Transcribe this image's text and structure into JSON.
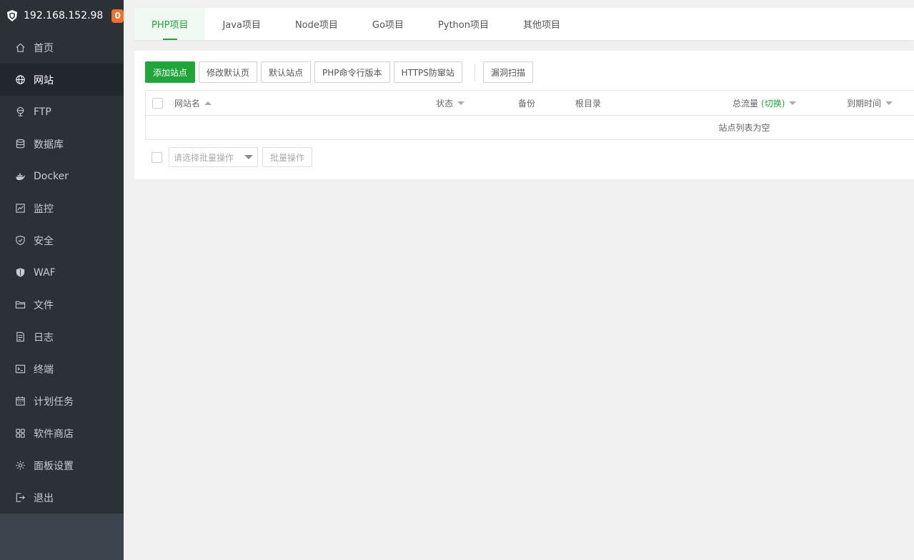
{
  "header": {
    "ip": "192.168.152.98",
    "badge": "0"
  },
  "nav": [
    {
      "label": "首页",
      "icon": "home-icon"
    },
    {
      "label": "网站",
      "icon": "globe-icon",
      "active": true
    },
    {
      "label": "FTP",
      "icon": "ftp-icon"
    },
    {
      "label": "数据库",
      "icon": "database-icon"
    },
    {
      "label": "Docker",
      "icon": "docker-icon"
    },
    {
      "label": "监控",
      "icon": "monitor-icon"
    },
    {
      "label": "安全",
      "icon": "shield-icon"
    },
    {
      "label": "WAF",
      "icon": "waf-icon"
    },
    {
      "label": "文件",
      "icon": "folder-icon"
    },
    {
      "label": "日志",
      "icon": "log-icon"
    },
    {
      "label": "终端",
      "icon": "terminal-icon"
    },
    {
      "label": "计划任务",
      "icon": "calendar-icon"
    },
    {
      "label": "软件商店",
      "icon": "grid-icon"
    },
    {
      "label": "面板设置",
      "icon": "gear-icon"
    },
    {
      "label": "退出",
      "icon": "logout-icon"
    }
  ],
  "tabs": [
    "PHP项目",
    "Java项目",
    "Node项目",
    "Go项目",
    "Python项目",
    "其他项目"
  ],
  "toolbar": {
    "add_site": "添加站点",
    "edit_default_page": "修改默认页",
    "default_site": "默认站点",
    "php_cli": "PHP命令行版本",
    "https_guard": "HTTPS防窜站",
    "vuln_scan": "漏洞扫描"
  },
  "table": {
    "col_name": "网站名",
    "col_status": "状态",
    "col_backup": "备份",
    "col_root": "根目录",
    "col_traffic": "总流量",
    "col_traffic_switch": "(切换)",
    "col_expire": "到期时间",
    "empty": "站点列表为空"
  },
  "batch": {
    "placeholder": "请选择批量操作",
    "button": "批量操作"
  },
  "colors": {
    "accent": "#20a53a",
    "sidebar": "#2c3138",
    "badge": "#f0712b"
  }
}
